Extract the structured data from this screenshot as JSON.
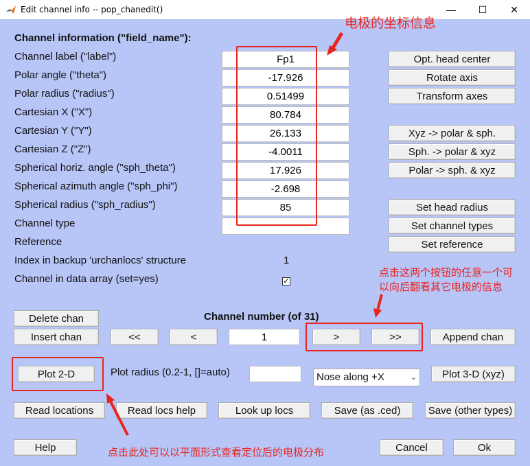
{
  "window": {
    "title": "Edit channel info -- pop_chanedit()",
    "minimize": "—",
    "maximize": "☐",
    "close": "✕"
  },
  "section_title": "Channel information (\"field_name\"):",
  "fields": [
    {
      "label": "Channel label (\"label\")",
      "value": "Fp1"
    },
    {
      "label": "Polar angle (\"theta\")",
      "value": "-17.926"
    },
    {
      "label": "Polar radius (\"radius\")",
      "value": "0.51499"
    },
    {
      "label": "Cartesian X (\"X\")",
      "value": "80.784"
    },
    {
      "label": "Cartesian Y (\"Y\")",
      "value": "26.133"
    },
    {
      "label": "Cartesian Z (\"Z\")",
      "value": "-4.0011"
    },
    {
      "label": "Spherical horiz. angle (\"sph_theta\")",
      "value": "17.926"
    },
    {
      "label": "Spherical azimuth angle (\"sph_phi\")",
      "value": "-2.698"
    },
    {
      "label": "Spherical radius (\"sph_radius\")",
      "value": "85"
    },
    {
      "label": "Channel type",
      "value": ""
    }
  ],
  "reference_label": "Reference",
  "index_backup": {
    "label": "Index in backup 'urchanlocs' structure",
    "value": "1"
  },
  "data_array": {
    "label": "Channel in data array (set=yes)",
    "checked": true,
    "check_glyph": "✓"
  },
  "right_buttons": {
    "opt_head_center": "Opt. head center",
    "rotate_axis": "Rotate axis",
    "transform_axes": "Transform axes",
    "xyz_polar": "Xyz -> polar & sph.",
    "sph_polar": "Sph. -> polar & xyz",
    "polar_sph": "Polar -> sph. & xyz",
    "set_head_radius": "Set head radius",
    "set_channel_types": "Set channel types",
    "set_reference": "Set reference"
  },
  "nav": {
    "delete_chan": "Delete chan",
    "insert_chan": "Insert chan",
    "channel_number_label": "Channel number (of 31)",
    "first": "<<",
    "prev": "<",
    "current": "1",
    "next": ">",
    "last": ">>",
    "append_chan": "Append chan"
  },
  "plot": {
    "plot_2d": "Plot 2-D",
    "plot_radius_label": "Plot radius (0.2-1, []=auto)",
    "plot_radius_value": "",
    "nose_select": "Nose along +X",
    "plot_3d": "Plot 3-D (xyz)"
  },
  "bottom_buttons": {
    "read_locations": "Read locations",
    "read_locs_help": "Read locs help",
    "look_up_locs": "Look up locs",
    "save_ced": "Save (as .ced)",
    "save_other": "Save (other types)",
    "help": "Help",
    "cancel": "Cancel",
    "ok": "Ok"
  },
  "annotations": {
    "coords_note": "电极的坐标信息",
    "nav_note_line1": "点击这两个按钮的任意一个可",
    "nav_note_line2": "以向后翻看其它电极的信息",
    "plot_note": "点击此处可以以平面形式查看定位后的电极分布"
  },
  "colors": {
    "panel_bg": "#b7c5f7",
    "annotation_red": "#e8241e"
  }
}
